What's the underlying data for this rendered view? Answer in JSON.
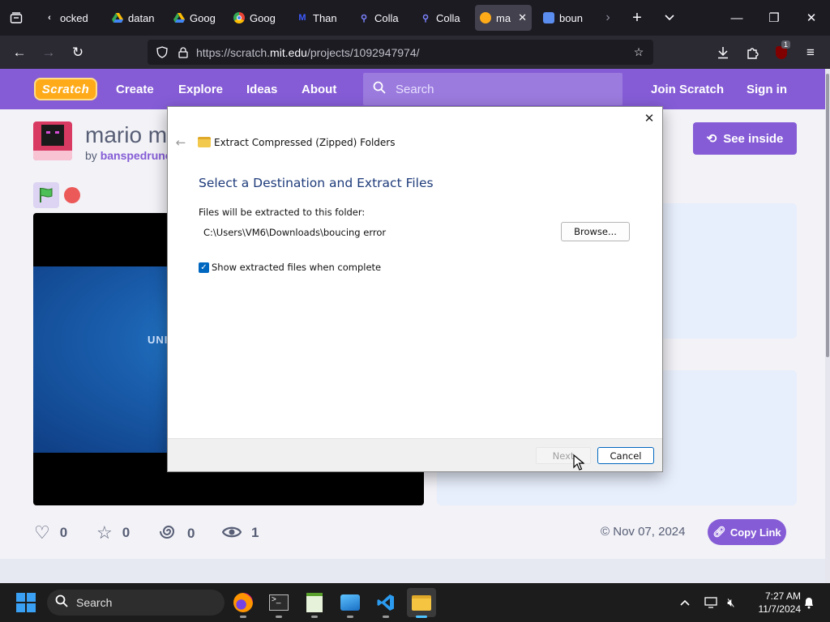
{
  "browser": {
    "tabs": [
      {
        "title": "ocked",
        "favicon": "back-icon",
        "color": "#fbfbfe"
      },
      {
        "title": "datan",
        "favicon": "drive-icon",
        "color": "#34a853"
      },
      {
        "title": "Goog",
        "favicon": "drive-icon",
        "color": "#fbbc04"
      },
      {
        "title": "Goog",
        "favicon": "chrome-icon",
        "color": "#ea4335"
      },
      {
        "title": "Than",
        "favicon": "m-icon",
        "color": "#3d5afe"
      },
      {
        "title": "Colla",
        "favicon": "magnifier-icon",
        "color": "#7c83ff"
      },
      {
        "title": "Colla",
        "favicon": "magnifier-icon",
        "color": "#7c83ff"
      },
      {
        "title": "ma",
        "favicon": "scratch-icon",
        "color": "#ffab19"
      },
      {
        "title": "boun",
        "favicon": "window-icon",
        "color": "#5b8def"
      }
    ],
    "url": {
      "prefix": "https://scratch.",
      "host": "mit.edu",
      "path": "/projects/1092947974/"
    },
    "extensions_badge": "1"
  },
  "scratch": {
    "logo_text": "Scratch",
    "nav": {
      "create": "Create",
      "explore": "Explore",
      "ideas": "Ideas",
      "about": "About",
      "search_placeholder": "Search",
      "join": "Join Scratch",
      "signin": "Sign in"
    },
    "project": {
      "title": "mario m",
      "by_prefix": "by",
      "author": "banspedruno",
      "see_inside": "See inside",
      "stage_text": "UNI"
    },
    "stats": {
      "loves": "0",
      "favorites": "0",
      "remixes": "0",
      "views": "1"
    },
    "date": "Nov 07, 2024",
    "copy_link": "Copy Link"
  },
  "dialog": {
    "window_title": "Extract Compressed (Zipped) Folders",
    "heading": "Select a Destination and Extract Files",
    "dest_label": "Files will be extracted to this folder:",
    "dest_path": "C:\\Users\\VM6\\Downloads\\boucing error",
    "browse": "Browse...",
    "show_files_label": "Show extracted files when complete",
    "show_files_checked": true,
    "next": "Next",
    "cancel": "Cancel"
  },
  "taskbar": {
    "search_label": "Search",
    "time": "7:27 AM",
    "date": "11/7/2024",
    "apps": [
      "firefox-icon",
      "terminal-icon",
      "notepad-icon",
      "photos-icon",
      "vscode-icon",
      "file-explorer-icon"
    ]
  },
  "colors": {
    "scratch_purple": "#855cd6",
    "scratch_orange": "#ffab19",
    "dialog_heading": "#1e3b7a",
    "windows_accent": "#0067c0"
  }
}
